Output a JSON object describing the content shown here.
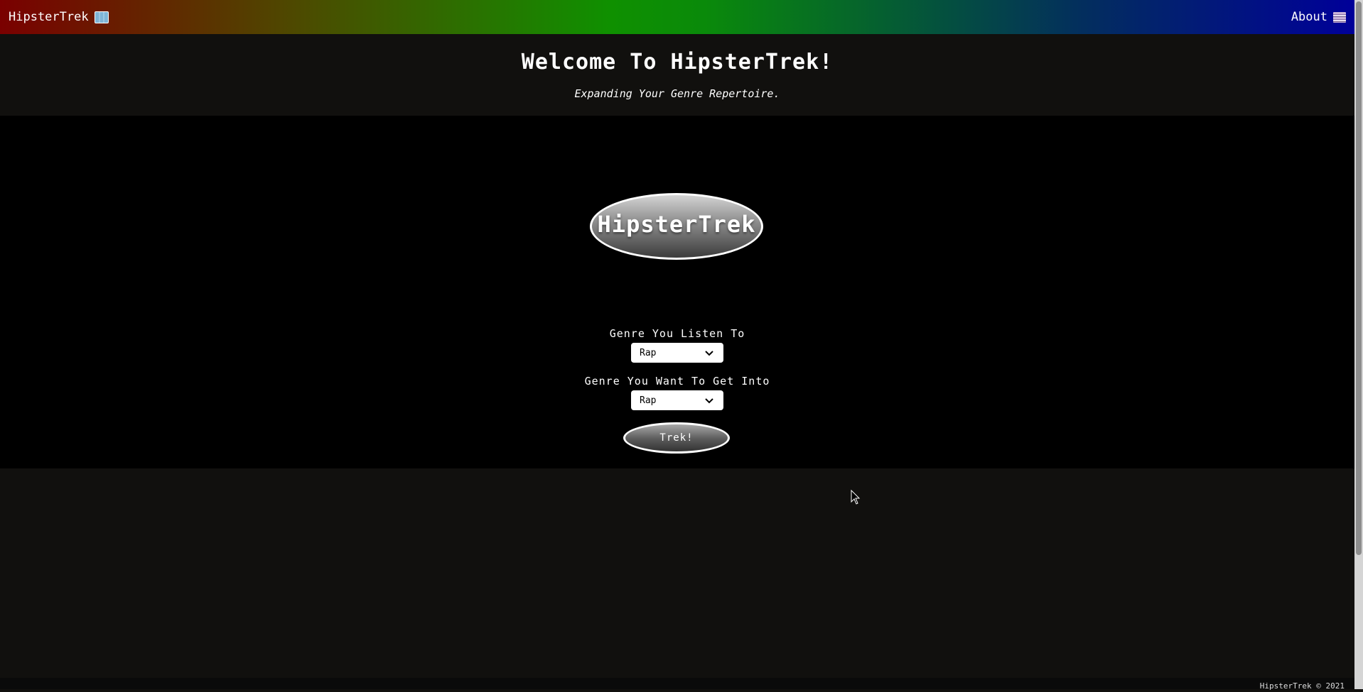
{
  "navbar": {
    "brand_label": "HipsterTrek",
    "brand_icon": "world-map-icon",
    "about_label": "About",
    "about_icon": "books-icon"
  },
  "header": {
    "title": "Welcome To HipsterTrek!",
    "subtitle": "Expanding Your Genre Repertoire."
  },
  "logo": {
    "text": "HipsterTrek"
  },
  "form": {
    "genre_current_label": "Genre You Listen To",
    "genre_current_value": "Rap",
    "genre_target_label": "Genre You Want To Get Into",
    "genre_target_value": "Rap",
    "submit_label": "Trek!"
  },
  "footer": {
    "text": "HipsterTrek © 2021"
  }
}
